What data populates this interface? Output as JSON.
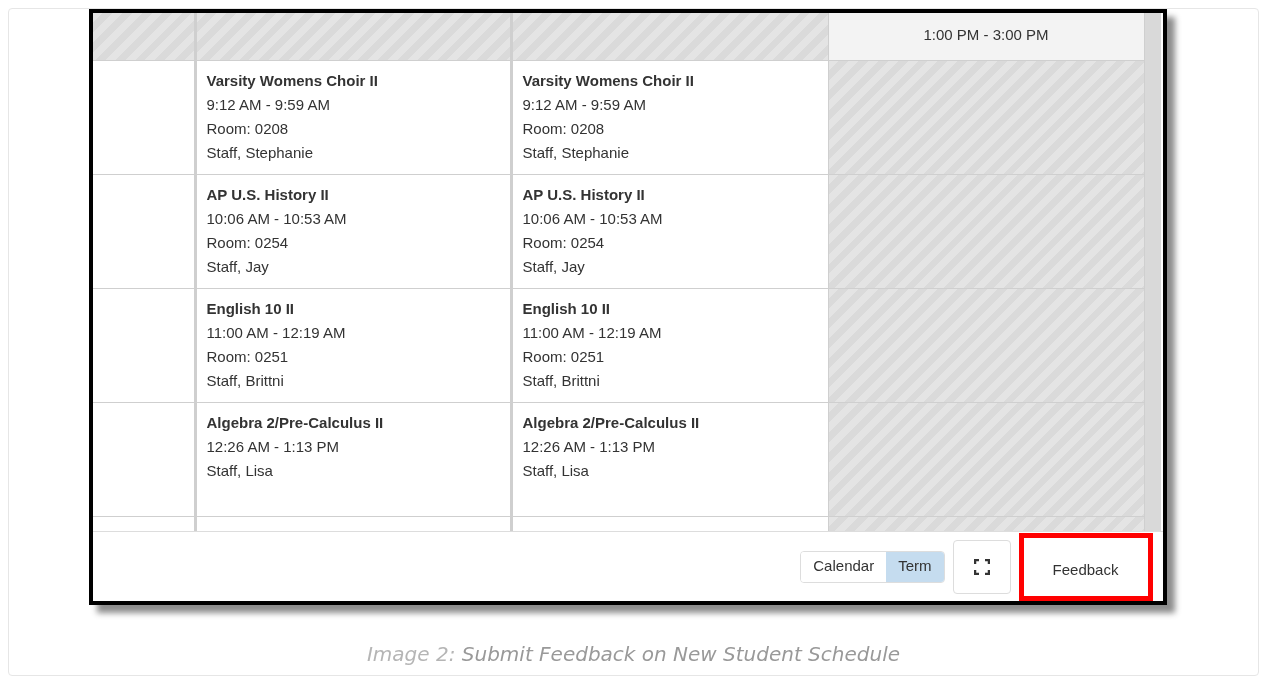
{
  "schedule": {
    "rows": [
      {
        "cells": [
          {
            "kind": "blocked"
          },
          {
            "kind": "blocked"
          },
          {
            "kind": "blocked"
          },
          {
            "kind": "time",
            "time": "1:00 PM - 3:00 PM"
          }
        ]
      },
      {
        "cells": [
          {
            "kind": "empty"
          },
          {
            "kind": "course",
            "title": "Varsity Womens Choir II",
            "time": "9:12 AM - 9:59 AM",
            "room": "Room: 0208",
            "staff": "Staff, Stephanie"
          },
          {
            "kind": "course",
            "title": "Varsity Womens Choir II",
            "time": "9:12 AM - 9:59 AM",
            "room": "Room: 0208",
            "staff": "Staff, Stephanie"
          },
          {
            "kind": "blocked"
          }
        ]
      },
      {
        "cells": [
          {
            "kind": "empty"
          },
          {
            "kind": "course",
            "title": "AP U.S. History II",
            "time": "10:06 AM - 10:53 AM",
            "room": "Room: 0254",
            "staff": "Staff, Jay"
          },
          {
            "kind": "course",
            "title": "AP U.S. History II",
            "time": "10:06 AM - 10:53 AM",
            "room": "Room: 0254",
            "staff": "Staff, Jay"
          },
          {
            "kind": "blocked"
          }
        ]
      },
      {
        "cells": [
          {
            "kind": "empty"
          },
          {
            "kind": "course",
            "title": "English 10 II",
            "time": "11:00 AM - 12:19 AM",
            "room": "Room: 0251",
            "staff": "Staff, Brittni"
          },
          {
            "kind": "course",
            "title": "English 10 II",
            "time": "11:00 AM - 12:19 AM",
            "room": "Room: 0251",
            "staff": "Staff, Brittni"
          },
          {
            "kind": "blocked"
          }
        ]
      },
      {
        "cells": [
          {
            "kind": "empty"
          },
          {
            "kind": "course",
            "title": "Algebra 2/Pre-Calculus II",
            "time": "12:26 AM - 1:13 PM",
            "staff": "Staff, Lisa"
          },
          {
            "kind": "course",
            "title": "Algebra 2/Pre-Calculus II",
            "time": "12:26 AM - 1:13 PM",
            "staff": "Staff, Lisa"
          },
          {
            "kind": "blocked"
          }
        ]
      },
      {
        "cells": [
          {
            "kind": "empty"
          },
          {
            "kind": "empty"
          },
          {
            "kind": "empty"
          },
          {
            "kind": "blocked"
          }
        ]
      }
    ]
  },
  "footer": {
    "views": [
      {
        "label": "Calendar",
        "selected": false
      },
      {
        "label": "Term",
        "selected": true
      }
    ],
    "feedback": {
      "label": "Feedback",
      "highlighted": true
    }
  },
  "caption": {
    "label": "Image 2:",
    "text": "Submit Feedback on New Student Schedule"
  }
}
